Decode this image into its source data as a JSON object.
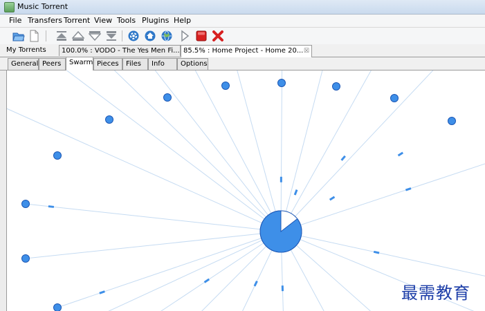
{
  "window": {
    "title": "Music Torrent"
  },
  "menu": [
    "File",
    "Transfers",
    "Torrent",
    "View",
    "Tools",
    "Plugins",
    "Help"
  ],
  "toolbar": {
    "icons": [
      "open-folder-icon",
      "new-document-icon",
      "move-top-icon",
      "move-up-icon",
      "move-down-icon",
      "move-bottom-icon",
      "settings-icon",
      "home-icon",
      "globe-icon",
      "play-icon",
      "stop-icon",
      "remove-icon"
    ],
    "colors": {
      "blue": "#2f78c8",
      "grey": "#8a8f96",
      "red": "#d72020"
    }
  },
  "torrent_tabs": [
    {
      "label": "My Torrents"
    },
    {
      "label": "100.0% : VODO - The Yes Men Fi..."
    },
    {
      "label": "85.5% : Home Project - Home 20...",
      "close": "☒"
    }
  ],
  "detail_tabs": [
    "General",
    "Peers",
    "Swarm",
    "Pieces",
    "Files",
    "Info",
    "Options"
  ],
  "active_detail_tab": "Swarm",
  "swarm": {
    "peer_count_visible": 15,
    "center_completion": 0.855,
    "colors": {
      "node": "#3e8fe8",
      "node_stroke": "#1c57b5",
      "line": "#c5dbf2",
      "packet": "#3e8fe8"
    }
  },
  "watermark": "最需教育"
}
